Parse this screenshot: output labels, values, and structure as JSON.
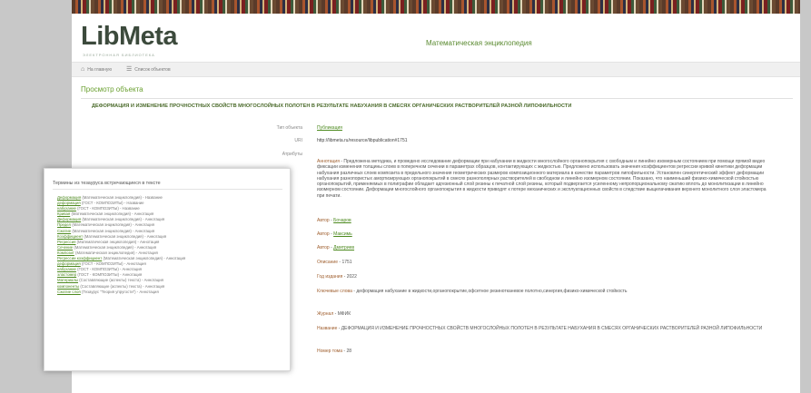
{
  "header": {
    "logo": "LibMeta",
    "logo_sub": "ЭЛЕКТРОННАЯ БИБЛИОТЕКА",
    "site_title": "Математическая энциклопедия"
  },
  "nav": {
    "home": "На главную",
    "list": "Список объектов"
  },
  "page": {
    "section_title": "Просмотр объекта",
    "heading": "ДЕФОРМАЦИЯ И ИЗМЕНЕНИЕ ПРОЧНОСТНЫХ СВОЙСТВ МНОГОСЛОЙНЫХ ПОЛОТЕН В РЕЗУЛЬТАТЕ НАБУХАНИЯ В СМЕСЯХ ОРГАНИЧЕСКИХ РАСТВОРИТЕЛЕЙ РАЗНОЙ ЛИПОФИЛЬНОСТИ"
  },
  "object": {
    "type_label": "Тип объекта",
    "type_value": "Публикация",
    "uri_label": "URI",
    "uri_value": "http://libmeta.ru/resource/libpublication#1751",
    "attrs_label": "Атрибуты",
    "abstract_key": "Аннотация",
    "abstract_text": "Предложена методика, и проведено исследование деформации при набухании в жидкости многослойного органопокрытия с свободным и линейно изомерным состоянием при помощи прямой видео фиксации изменения толщины слоев в поперечном сечении в параметрах образцов, контактирующих с жидкостью. Предложено использовать значения коэффициентов регрессии кривой кинетики деформации набухания различных слоев композита в предельного значения геометрических размеров композиционного материала в качестве параметров липофильности. Установлен синергетический эффект деформации набухания разнопористых амортизирующих органопокрытий в смесях разнополярных растворителей в свободном и линейно изомерном состоянии. Показано, что наименьший физико-химической стойкостью органопокрытий, применяемых в полиграфии обладает адгезионный слой резины к печатной слой резины, который подвергается усиленному непропорциональному сжатию вплоть до монолитизации в линейно изомерном состоянии. Деформации многослойного органопокрытия в жидкости приводят к потере механических и эксплуатационных свойств в следствие выщелачивания верхнего монолитного слоя эластомера при печати.",
    "rows": [
      {
        "key": "Автор",
        "value": "Бочаров",
        "link": true
      },
      {
        "key": "Автор",
        "value": "Максимь",
        "link": true
      },
      {
        "key": "Автор",
        "value": "Дмитриев",
        "link": true
      },
      {
        "key": "Описание",
        "value": "1751",
        "link": false
      },
      {
        "key": "Год издания",
        "value": "2022",
        "link": false
      },
      {
        "key": "Ключевые слова",
        "value": "деформация набухание в жидкости,органопокрытие,офсетное резинотканевое полотно,синергия,физико-химической стойкость",
        "link": false
      },
      {
        "key": "Журнал",
        "value": "МФИК",
        "link": false
      },
      {
        "key": "Название",
        "value": "ДЕФОРМАЦИЯ И ИЗМЕНЕНИЕ ПРОЧНОСТНЫХ СВОЙСТВ МНОГОСЛОЙНЫХ ПОЛОТЕН В РЕЗУЛЬТАТЕ НАБУХАНИЯ В СМЕСЯХ ОРГАНИЧЕСКИХ РАСТВОРИТЕЛЕЙ РАЗНОЙ ЛИПОФИЛЬНОСТИ",
        "link": false
      },
      {
        "key": "Номер тома",
        "value": "28",
        "link": false
      }
    ]
  },
  "terms_panel": {
    "title": "Термины из тезауруса встречающиеся в тексте",
    "items": [
      {
        "term": "Деформация",
        "source": "(Математическая энциклопедия) - Название"
      },
      {
        "term": "деформация",
        "source": "(ГОСТ - КОМПОЗИТЫ) - Название"
      },
      {
        "term": "набухание",
        "source": "(ГОСТ - КОМПОЗИТЫ) - Название"
      },
      {
        "term": "Кривая",
        "source": "(Математическая энциклопедия) - Аннотация"
      },
      {
        "term": "Деформация",
        "source": "(Математическая энциклопедия) - Аннотация"
      },
      {
        "term": "Предел",
        "source": "(Математическая энциклопедия) - Аннотация"
      },
      {
        "term": "Сжатие",
        "source": "(Математическая энциклопедия) - Аннотация"
      },
      {
        "term": "Коэффициент",
        "source": "(Математическая энциклопедия) - Аннотация"
      },
      {
        "term": "Регрессия",
        "source": "(Математическая энциклопедия) - Аннотация"
      },
      {
        "term": "Сечение",
        "source": "(Математическая энциклопедия) - Аннотация"
      },
      {
        "term": "Композит",
        "source": "(Математическая энциклопедия) - Аннотация"
      },
      {
        "term": "Регрессии коэффициент",
        "source": "(Математическая энциклопедия) - Аннотация"
      },
      {
        "term": "деформация",
        "source": "(ГОСТ - КОМПОЗИТЫ) - Аннотация"
      },
      {
        "term": "набухание",
        "source": "(ГОСТ - КОМПОЗИТЫ) - Аннотация"
      },
      {
        "term": "эластомер",
        "source": "(ГОСТ - КОМПОЗИТЫ) - Аннотация"
      },
      {
        "term": "Материалы",
        "source": "(Составляющие (аспекты) текста) - Аннотация"
      },
      {
        "term": "компоненты",
        "source": "(Составляющие (аспекты) текста) - Аннотация"
      },
      {
        "term": "Сжатие слоя",
        "source": "(Тезаурус \"Теория упругости\") - Аннотация"
      }
    ]
  }
}
